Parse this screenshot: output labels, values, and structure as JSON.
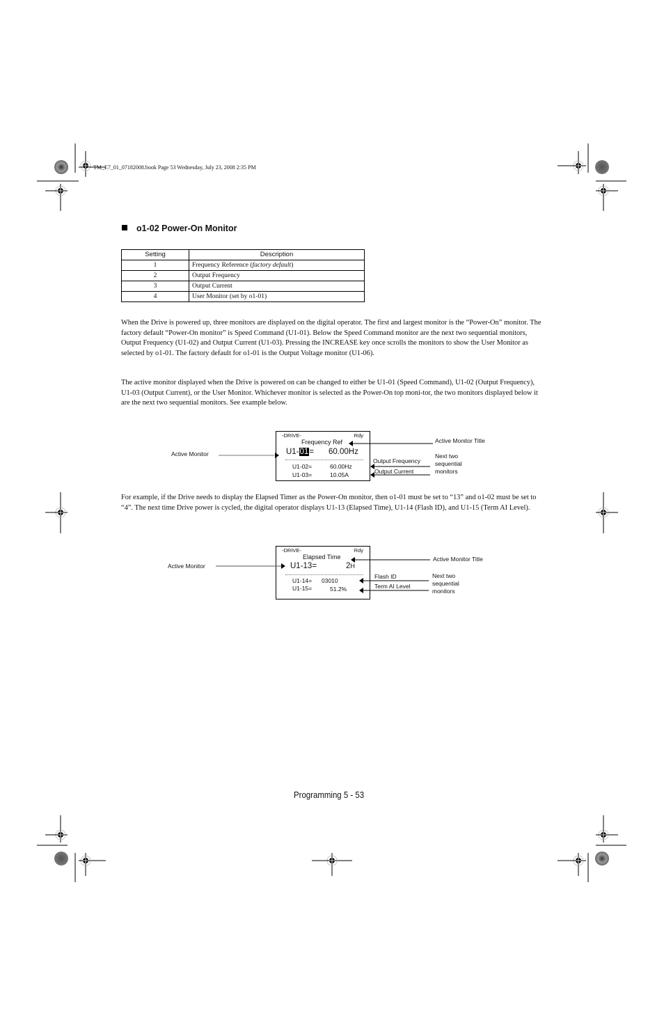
{
  "print_header": "TM_E7_01_07182008.book  Page 53  Wednesday, July 23, 2008  2:35 PM",
  "section": {
    "title": "o1-02  Power-On Monitor"
  },
  "settings_table": {
    "headers": [
      "Setting",
      "Description"
    ],
    "rows": [
      {
        "setting": "1",
        "description": "Frequency Reference (",
        "description_italic": "factory default",
        "description_suffix": ")"
      },
      {
        "setting": "2",
        "description": "Output Frequency"
      },
      {
        "setting": "3",
        "description": "Output Current"
      },
      {
        "setting": "4",
        "description": "User Monitor (set by o1-01)"
      }
    ]
  },
  "paragraphs": [
    "When the Drive is powered up, three monitors are displayed on the digital operator. The first and largest monitor is the “Power-On” monitor. The factory default “Power-On monitor” is Speed Command (U1-01). Below the Speed Command monitor are the next two sequential monitors, Output Frequency (U1-02) and Output Current (U1-03). Pressing the INCREASE key once scrolls the monitors to show the User Monitor as selected by o1-01. The factory default for o1-01 is the Output Voltage monitor (U1-06).",
    "The active monitor displayed when the Drive is powered on can be changed to either be U1-01 (Speed Command), U1-02 (Output Frequency), U1-03 (Output Current), or the User Monitor. Whichever monitor is selected as the Power-On top moni-tor, the two monitors displayed below it are the next two sequential monitors. See example below.",
    "For example, if the Drive needs to display the Elapsed Timer as the Power-On monitor, then o1-01 must be set to “13” and o1-02 must be set to “4”. The next time Drive power is cycled, the digital operator displays U1-13 (Elapsed Time), U1-14 (Flash ID), and U1-15 (Term AI Level)."
  ],
  "figure1": {
    "display": {
      "mode": "-DRIVE-",
      "status": "Rdy",
      "title": "Frequency Ref",
      "main_prefix": "U1-",
      "main_highlight": "01",
      "main_suffix": "=",
      "main_value": "60.00Hz",
      "sub1_param": "U1-02=",
      "sub1_value": "60.00Hz",
      "sub2_param": "U1-03=",
      "sub2_value": "10.05A"
    },
    "callouts": {
      "active_monitor": "Active Monitor",
      "active_monitor_title": "Active Monitor Title",
      "sub1": "Output Frequency",
      "sub2": "Output Current",
      "next_two_line1": "Next two",
      "next_two_line2": "sequential",
      "next_two_line3": "monitors"
    }
  },
  "figure2": {
    "display": {
      "mode": "-DRIVE-",
      "status": "Rdy",
      "title": "Elapsed Time",
      "main_param": "U1-13=",
      "main_value": "2",
      "main_unit": "H",
      "sub1_param": "U1-14=",
      "sub1_value": "03010",
      "sub2_param": "U1-15=",
      "sub2_value": "51.2%"
    },
    "callouts": {
      "active_monitor": "Active Monitor",
      "active_monitor_title": "Active Monitor Title",
      "sub1": "Flash ID",
      "sub2": "Term AI Level",
      "next_two_line1": "Next two",
      "next_two_line2": "sequential",
      "next_two_line3": "monitors"
    }
  },
  "footer": {
    "page_label": "Programming  5 - 53"
  }
}
